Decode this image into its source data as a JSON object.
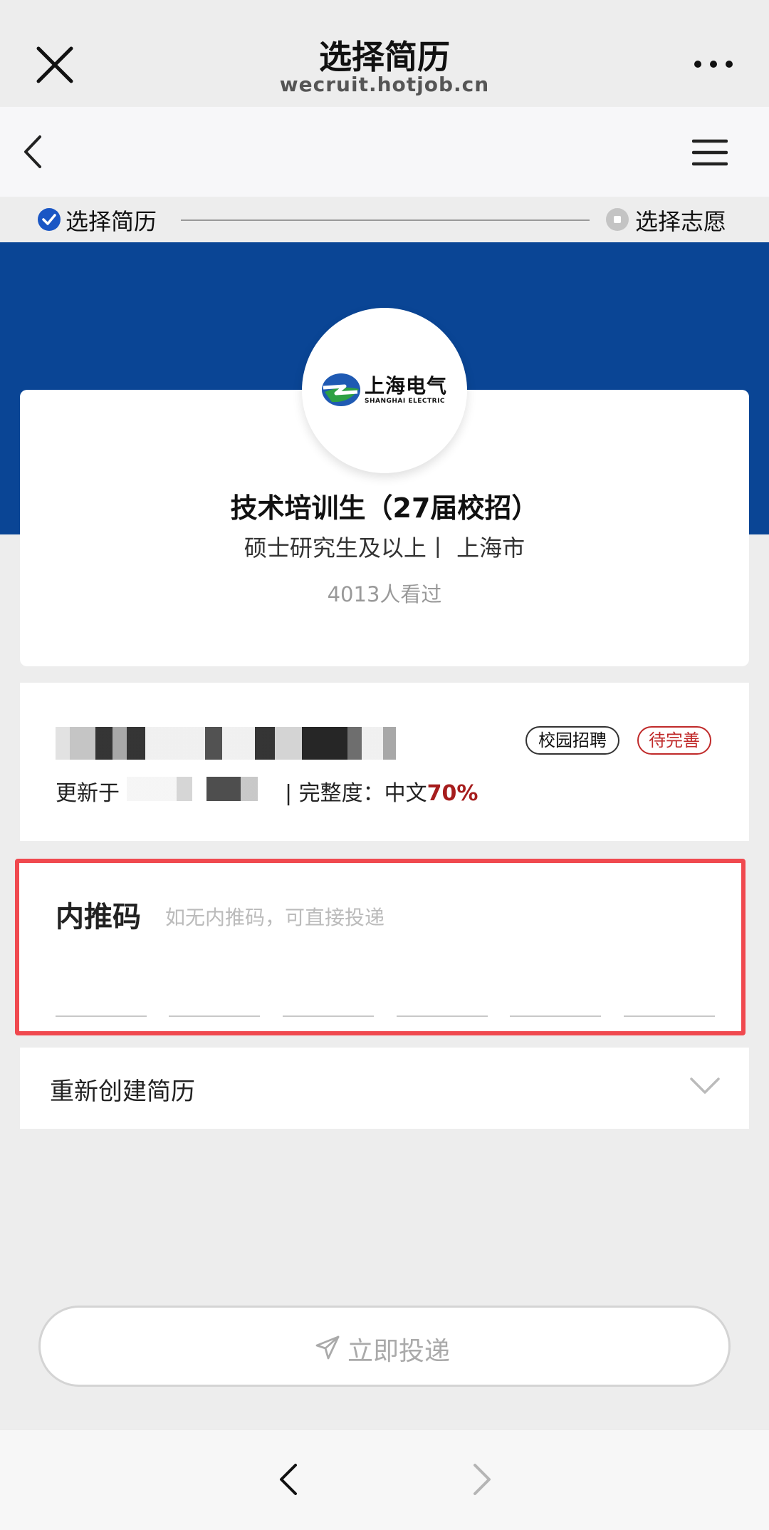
{
  "wechat_bar": {
    "title": "选择简历",
    "domain": "wecruit.hotjob.cn"
  },
  "steps": [
    {
      "label": "选择简历",
      "state": "done"
    },
    {
      "label": "选择志愿",
      "state": "pending"
    }
  ],
  "company": {
    "logo_cn": "上海电气",
    "logo_en": "SHANGHAI ELECTRIC"
  },
  "job": {
    "title": "技术培训生（27届校招）",
    "meta": "硕士研究生及以上丨 上海市",
    "views": "4013人看过"
  },
  "resume": {
    "tag_campus": "校园招聘",
    "tag_pending": "待完善",
    "updated_label": "更新于",
    "completeness_label": "| 完整度：中文",
    "completeness_value": "70%"
  },
  "referral": {
    "title": "内推码",
    "hint": "如无内推码，可直接投递"
  },
  "recreate": {
    "label": "重新创建简历"
  },
  "submit": {
    "label": "立即投递"
  },
  "icons": {
    "close": "close-icon",
    "more": "more-icon",
    "back": "chevron-left-icon",
    "menu": "menu-icon",
    "check": "check-circle-icon",
    "step_pending": "dot-circle-icon",
    "dropdown": "chevron-down-icon",
    "send": "paper-plane-icon",
    "forward": "chevron-right-icon"
  },
  "colors": {
    "banner_blue": "#0a4595",
    "step_check_blue": "#1a56c4",
    "highlight_red": "#f0494f",
    "pending_red": "#c02a2a",
    "percent_red": "#a61d1d"
  }
}
